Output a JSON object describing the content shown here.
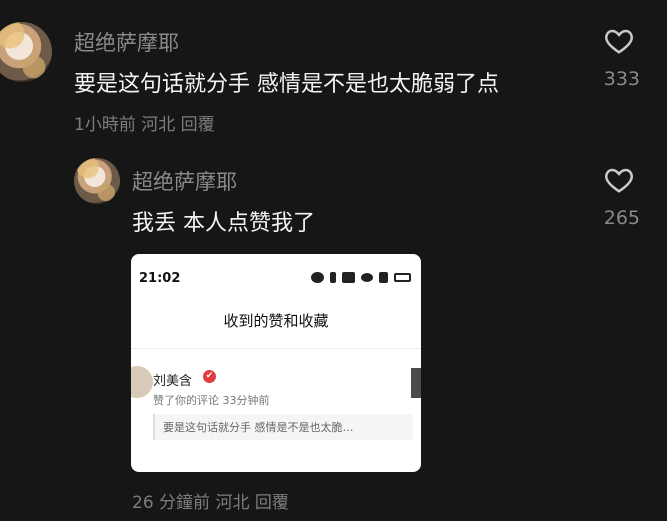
{
  "comments": [
    {
      "username": "超绝萨摩耶",
      "text": "要是这句话就分手 感情是不是也太脆弱了点",
      "meta": "1小時前 河北 回覆",
      "likes": "333"
    },
    {
      "username": "超绝萨摩耶",
      "text": "我丢 本人点赞我了",
      "meta": "26 分鐘前 河北 回覆",
      "likes": "265"
    }
  ],
  "screenshot_card": {
    "time": "21:02",
    "title": "收到的赞和收藏",
    "user_name": "刘美含",
    "badge": "✔",
    "action": "赞了你的评论  33分钟前",
    "quote": "要是这句话就分手 感情是不是也太脆…",
    "status_icons": [
      "alarm-icon",
      "bluetooth-icon",
      "hd-icon",
      "wifi-icon",
      "signal-icon",
      "battery-icon"
    ]
  },
  "colors": {
    "background": "#161616",
    "username": "#8a8a8a",
    "text": "#f4f4f4",
    "meta": "#7d7d7d",
    "badge": "#e23c3c"
  }
}
